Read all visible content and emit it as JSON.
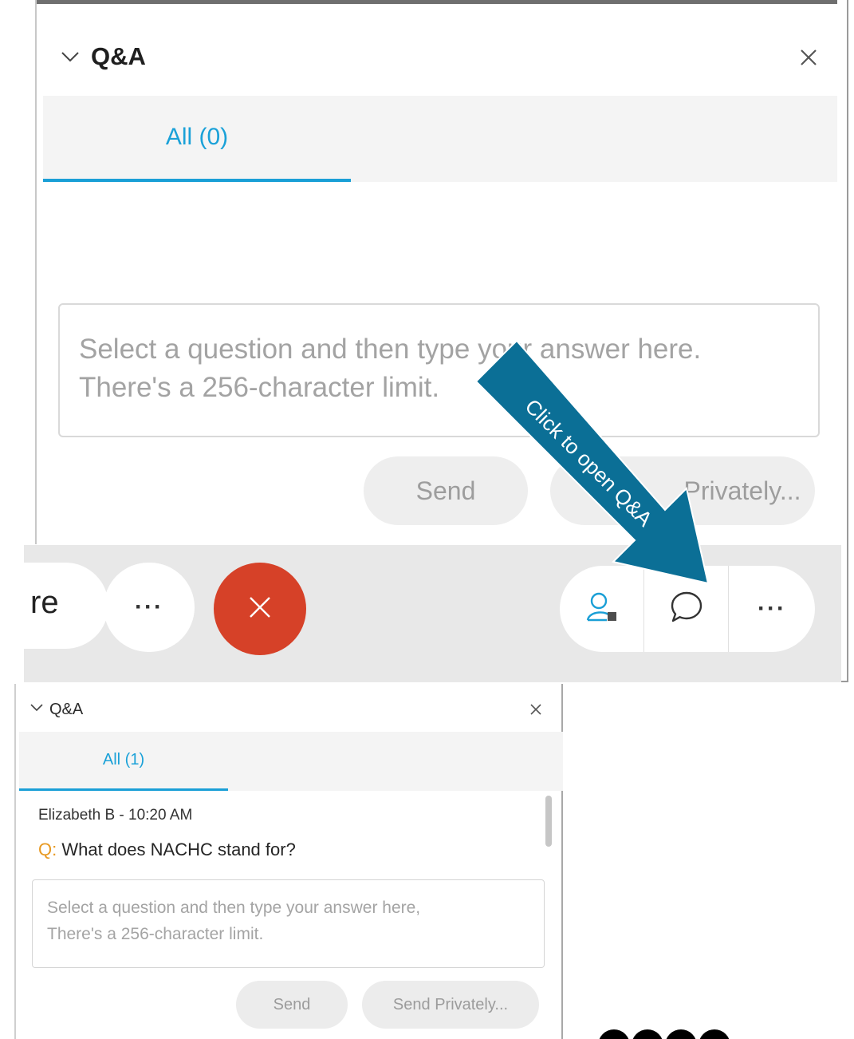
{
  "top_panel": {
    "title": "Q&A",
    "tab_all": "All (0)",
    "input_placeholder_line1": "Select a question and then type your answer here.",
    "input_placeholder_line2": "There's a 256-character limit.",
    "send_label": "Send",
    "send_private_label": "Privately...",
    "toolbar": {
      "share_partial_label": "re",
      "more_label": "···",
      "more_right_label": "···"
    }
  },
  "callout": {
    "text": "Click to open Q&A",
    "color": "#0b6f96"
  },
  "bottom_panel": {
    "title": "Q&A",
    "tab_all": "All (1)",
    "author": "Elizabeth B - 10:20 AM",
    "question_prefix": "Q:",
    "question_text": "What does NACHC stand for?",
    "input_placeholder_line1": "Select a question and then type your answer here,",
    "input_placeholder_line2": "There's a 256-character limit.",
    "send_label": "Send",
    "send_private_label": "Send Privately..."
  },
  "colors": {
    "accent_blue": "#1aa1d8",
    "leave_red": "#d64128",
    "question_prefix": "#e89a23"
  }
}
